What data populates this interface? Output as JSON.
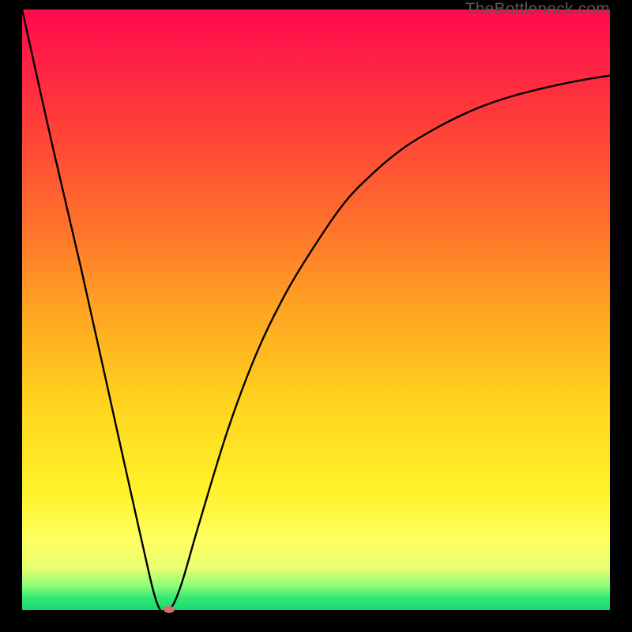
{
  "watermark": "TheBottleneck.com",
  "chart_data": {
    "type": "line",
    "title": "",
    "xlabel": "",
    "ylabel": "",
    "xlim": [
      0,
      100
    ],
    "ylim": [
      0,
      100
    ],
    "grid": false,
    "legend": false,
    "series": [
      {
        "name": "bottleneck-curve",
        "x": [
          0,
          5,
          10,
          15,
          20,
          23,
          25,
          27,
          30,
          35,
          40,
          45,
          50,
          55,
          60,
          65,
          70,
          75,
          80,
          85,
          90,
          95,
          100
        ],
        "values": [
          100,
          78,
          57,
          35,
          13,
          1,
          0,
          4,
          14,
          30,
          43,
          53,
          61,
          68,
          73,
          77,
          80,
          82.5,
          84.5,
          86,
          87.2,
          88.2,
          89
        ],
        "color": "#000000"
      }
    ],
    "minimum_marker": {
      "x": 25,
      "y": 0,
      "color": "#d36e6e"
    },
    "background_gradient": {
      "orientation": "vertical",
      "stops": [
        {
          "pos": 0.0,
          "color": "#ff0a4d"
        },
        {
          "pos": 0.18,
          "color": "#ff3b3a"
        },
        {
          "pos": 0.5,
          "color": "#ffa423"
        },
        {
          "pos": 0.8,
          "color": "#fff22a"
        },
        {
          "pos": 0.96,
          "color": "#8cff76"
        },
        {
          "pos": 1.0,
          "color": "#1bd96f"
        }
      ]
    }
  }
}
